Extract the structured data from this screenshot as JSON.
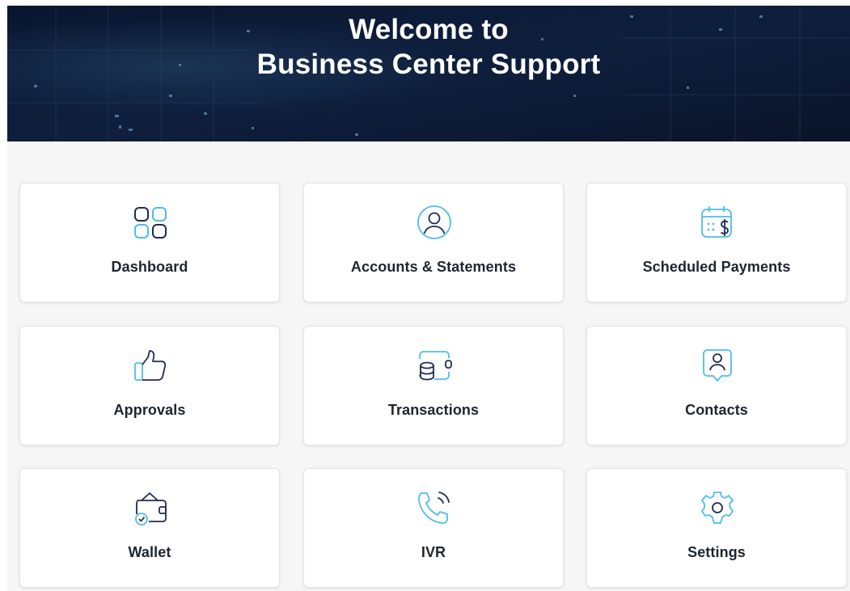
{
  "hero": {
    "title_line1": "Welcome to",
    "title_line2": "Business Center Support"
  },
  "colors": {
    "hero_background": "#0c1a33",
    "page_background": "#f6f6f7",
    "icon_dark": "#1f2b52",
    "icon_accent": "#4dbde9",
    "label_text": "#1e2530"
  },
  "cards": [
    {
      "label": "Dashboard",
      "icon": "grid-icon"
    },
    {
      "label": "Accounts & Statements",
      "icon": "user-circle-icon"
    },
    {
      "label": "Scheduled Payments",
      "icon": "calendar-dollar-icon"
    },
    {
      "label": "Approvals",
      "icon": "thumbs-up-icon"
    },
    {
      "label": "Transactions",
      "icon": "coins-transfer-icon"
    },
    {
      "label": "Contacts",
      "icon": "contact-card-icon"
    },
    {
      "label": "Wallet",
      "icon": "wallet-icon"
    },
    {
      "label": "IVR",
      "icon": "phone-call-icon"
    },
    {
      "label": "Settings",
      "icon": "gear-icon"
    }
  ]
}
